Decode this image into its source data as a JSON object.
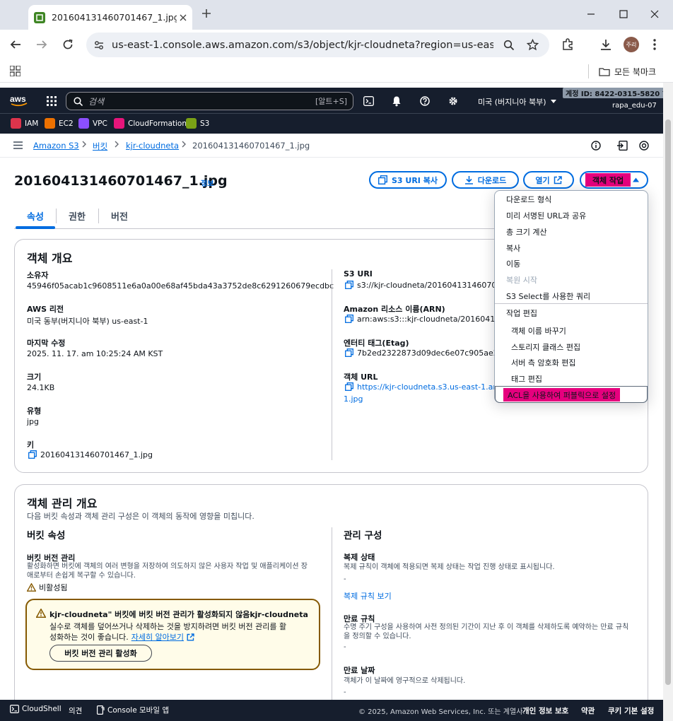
{
  "browser": {
    "tab_title": "201604131460701467_1.jpg - S",
    "url": "us-east-1.console.aws.amazon.com/s3/object/kjr-cloudneta?region=us-east-1&prefi...",
    "profile_initials": "주리",
    "bookmarks_label": "모든 북마크"
  },
  "aws": {
    "search_placeholder": "검색",
    "search_shortcut": "[알트+S]",
    "region": "미국 (버지니아 북부)",
    "account_id": "계정 ID: 8422-0315-5820",
    "user": "rapa_edu-07",
    "favorites": [
      {
        "label": "IAM",
        "color": "#dd344c"
      },
      {
        "label": "EC2",
        "color": "#ed7100"
      },
      {
        "label": "VPC",
        "color": "#8c4fff"
      },
      {
        "label": "CloudFormation",
        "color": "#e7157b"
      },
      {
        "label": "S3",
        "color": "#7aa116"
      }
    ]
  },
  "breadcrumb": {
    "items": [
      "Amazon S3",
      "버킷",
      "kjr-cloudneta",
      "201604131460701467_1.jpg"
    ]
  },
  "page": {
    "title": "201604131460701467_1.jpg",
    "info": "정보",
    "copy_uri_btn": "S3 URI 복사",
    "download_btn": "다운로드",
    "open_btn": "열기",
    "actions_btn": "객체 작업"
  },
  "tabs": [
    "속성",
    "권한",
    "버전"
  ],
  "overview": {
    "heading": "객체 개요",
    "owner_label": "소유자",
    "owner_value": "45946f05acab1c9608511e6a0a00e68af45bda43a3752de8c6291260679ecdbc",
    "region_label": "AWS 리전",
    "region_value": "미국 동부(버지니아 북부) us-east-1",
    "modified_label": "마지막 수정",
    "modified_value": "2025. 11. 17. am 10:25:24 AM KST",
    "size_label": "크기",
    "size_value": "24.1KB",
    "type_label": "유형",
    "type_value": "jpg",
    "key_label": "키",
    "key_value": "201604131460701467_1.jpg",
    "s3uri_label": "S3 URI",
    "s3uri_value": "s3://kjr-cloudneta/201604131460701",
    "arn_label": "Amazon 리소스 이름(ARN)",
    "arn_value": "arn:aws:s3:::kjr-cloudneta/20160413146",
    "etag_label": "엔터티 태그(Etag)",
    "etag_value": "7b2ed2322873d09dec6e07c905ae2ba",
    "url_label": "객체 URL",
    "url_value_1": "https://kjr-cloudneta.s3.us-east-1.ama",
    "url_value_2": "1.jpg"
  },
  "dropdown": {
    "items_top": [
      "다운로드 형식",
      "미리 서명된 URL과 공유",
      "총 크기 계산",
      "복사",
      "이동",
      "복원 시작",
      "S3 Select를 사용한 쿼리"
    ],
    "group_label": "작업 편집",
    "items_sub": [
      "객체 이름 바꾸기",
      "스토리지 클래스 편집",
      "서버 측 암호화 편집",
      "태그 편집"
    ],
    "highlighted": "ACL을 사용하여 퍼블릭으로 설정"
  },
  "management": {
    "heading": "객체 관리 개요",
    "description": "다음 버킷 속성과 객체 관리 구성은 이 객체의 동작에 영향을 미칩니다.",
    "bucket_props_heading": "버킷 속성",
    "versioning_label": "버킷 버전 관리",
    "versioning_desc_1": "활성화하면 버킷에 객체의 여러 변형을 저장하여 의도하지 않은 사용자 작업 및 애플리케이션 장",
    "versioning_desc_2": "애로부터 손쉽게 복구할 수 있습니다.",
    "versioning_status": "비활성됨",
    "alert_title": "kjr-cloudneta\" 버킷에 버킷 버전 관리가 활성화되지 않음kjr-cloudneta",
    "alert_body_1": "실수로 객체를 덮어쓰거나 삭제하는 것을 방지하려면 버킷 버전 관리를 활",
    "alert_body_2": "성화하는 것이 좋습니다.",
    "alert_link": "자세히 알아보기",
    "enable_btn": "버킷 버전 관리 활성화",
    "mgmt_heading": "관리 구성",
    "replication_label": "복제 상태",
    "replication_desc": "복제 규칙이 객체에 적용되면 복제 상태는 작업 진행 상태로 표시됩니다.",
    "replication_value": "-",
    "replication_link": "복제 규칙 보기",
    "expiration_rule_label": "만료 규칙",
    "expiration_rule_desc_1": "수명 주기 구성을 사용하여 사전 정의된 기간이 지난 후 이 객체를 삭제하도록 예약하는 만료 규칙",
    "expiration_rule_desc_2": "을 정의할 수 있습니다.",
    "expiration_rule_value": "-",
    "expiration_date_label": "만료 날짜",
    "expiration_date_desc": "객체가 이 날짜에 영구적으로 삭제됩니다.",
    "expiration_date_value": "-"
  },
  "footer": {
    "cloudshell": "CloudShell",
    "feedback": "의견",
    "mobile": "Console 모바일 앱",
    "copyright": "© 2025, Amazon Web Services, Inc. 또는 계열사.",
    "privacy": "개인 정보 보호",
    "terms": "약관",
    "cookies": "쿠키 기본 설정"
  }
}
